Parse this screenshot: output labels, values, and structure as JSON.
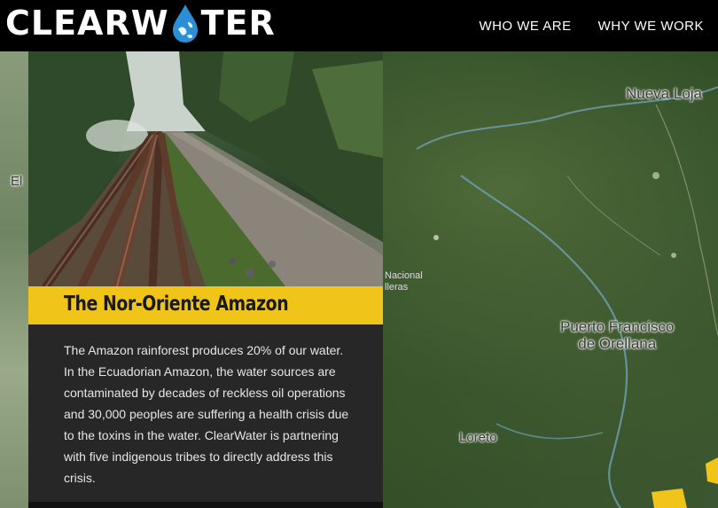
{
  "header": {
    "logo_text_left": "CLEARW",
    "logo_text_right": "TER",
    "logo_icon": "water-drop-globe-icon",
    "nav": [
      {
        "label": "WHO WE ARE"
      },
      {
        "label": "WHY WE WORK"
      }
    ]
  },
  "card": {
    "title": "The Nor-Oriente Amazon",
    "description": "The Amazon rainforest produces 20% of our water. In the Ecuadorian Amazon, the water sources are contaminated by decades of reckless oil operations and 30,000 peoples are suffering a health crisis due to the toxins in the water. ClearWater is partnering with five indigenous tribes to directly address this crisis.",
    "photo_subject": "oil-pipelines-along-jungle-road"
  },
  "map": {
    "labels": {
      "nueva_loja": "Nueva Loja",
      "puerto_1": "Puerto Francisco",
      "puerto_2": "de Orellana",
      "loreto": "Loreto",
      "edge_el": "El",
      "edge_nac": "Nacional",
      "edge_lleras": "lleras"
    }
  },
  "colors": {
    "header_bg": "#000000",
    "accent_yellow": "#f0c419",
    "panel_dark": "#272727",
    "drop_blue": "#2a8fd6"
  }
}
